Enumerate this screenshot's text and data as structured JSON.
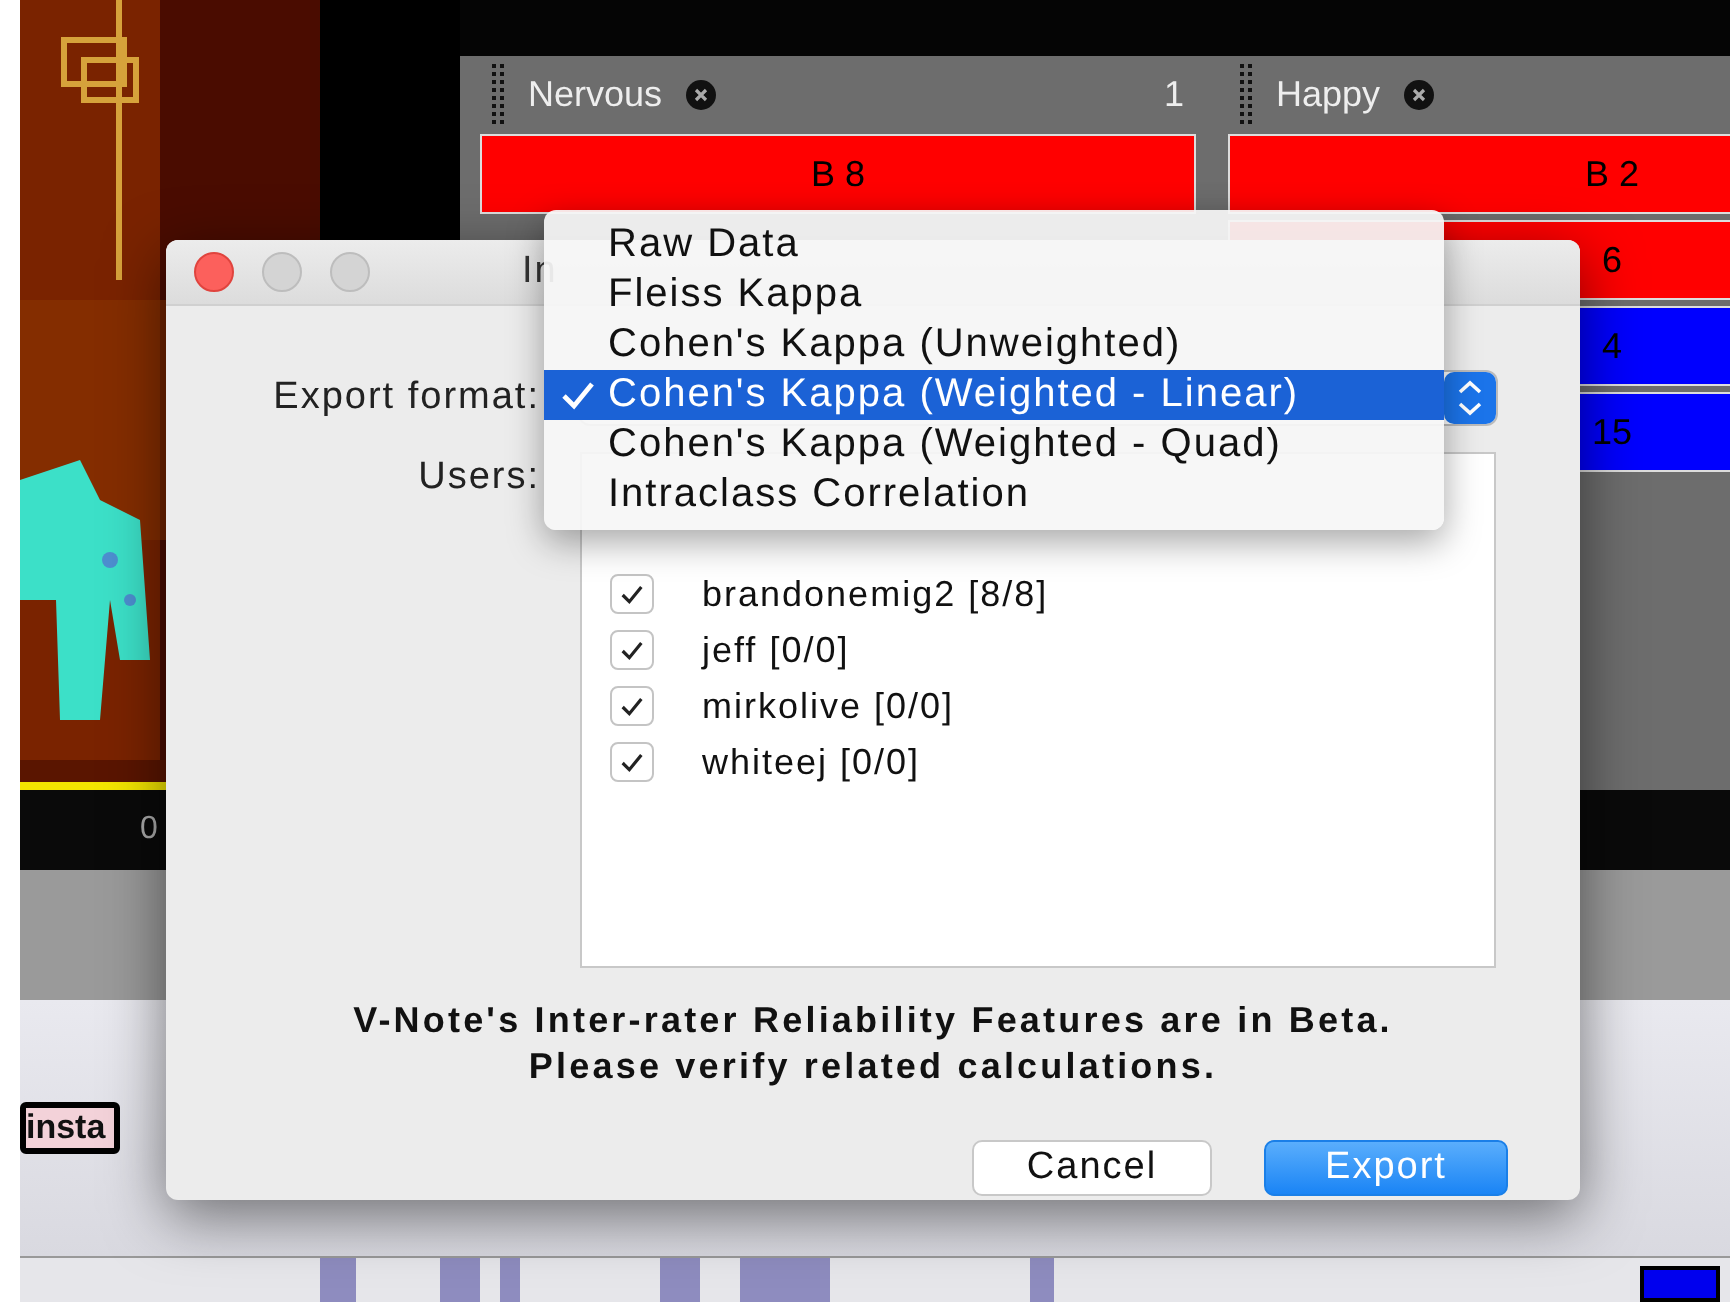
{
  "board": {
    "columns": [
      {
        "title": "Nervous",
        "count": "1",
        "cells": [
          {
            "label": "B 8",
            "color": "#ff0000"
          }
        ]
      },
      {
        "title": "Happy",
        "cells": [
          {
            "label": "B 2",
            "color": "#ff0000"
          },
          {
            "label": "6",
            "color": "#ff0000"
          },
          {
            "label": "4",
            "color": "#0000ff"
          },
          {
            "label": "15",
            "color": "#0000ff"
          }
        ]
      }
    ]
  },
  "timeline": {
    "time": "0",
    "tag": "insta"
  },
  "dialog": {
    "title": "In",
    "export_format_label": "Export format:",
    "users_label": "Users:",
    "users": [
      {
        "name": "brandonemig2 [8/8]",
        "checked": true
      },
      {
        "name": "jeff [0/0]",
        "checked": true
      },
      {
        "name": "mirkolive [0/0]",
        "checked": true
      },
      {
        "name": "whiteej [0/0]",
        "checked": true
      }
    ],
    "notice": [
      "V-Note's Inter-rater Reliability Features are in Beta.",
      "Please verify related calculations."
    ],
    "buttons": [
      {
        "label": "Cancel",
        "kind": "secondary"
      },
      {
        "label": "Export",
        "kind": "primary"
      }
    ]
  },
  "format_menu": {
    "options": [
      {
        "label": "Raw Data",
        "selected": false
      },
      {
        "label": "Fleiss Kappa",
        "selected": false
      },
      {
        "label": "Cohen's Kappa (Unweighted)",
        "selected": false
      },
      {
        "label": "Cohen's Kappa (Weighted - Linear)",
        "selected": true
      },
      {
        "label": "Cohen's Kappa (Weighted - Quad)",
        "selected": false
      },
      {
        "label": "Intraclass Correlation",
        "selected": false
      }
    ]
  }
}
